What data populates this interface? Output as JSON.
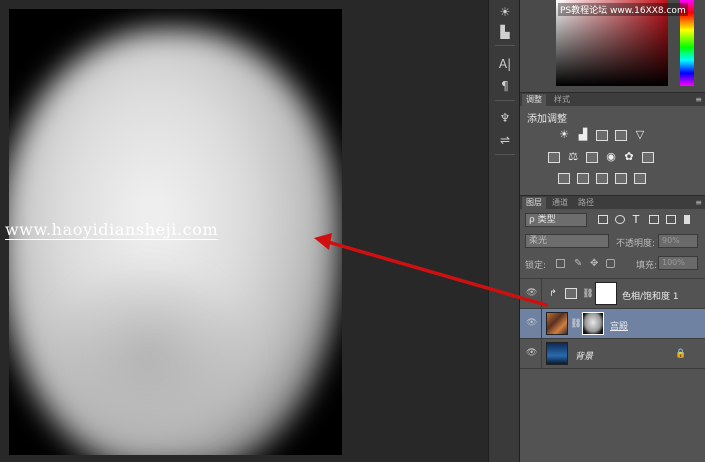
{
  "canvas": {
    "watermark": "www.haoyidiansheji.com"
  },
  "color_panel": {
    "credit": "PS教程论坛 www.16XX8.com",
    "accent_color": "#c01018"
  },
  "adjustments": {
    "tabs": [
      "调整",
      "样式"
    ],
    "title": "添加调整"
  },
  "layers": {
    "tabs": [
      "图层",
      "通道",
      "路径"
    ],
    "kind_select": "ρ 类型",
    "blend_mode": "柔光",
    "opacity_label": "不透明度:",
    "opacity_value": "90%",
    "lock_label": "锁定:",
    "fill_label": "填充:",
    "fill_value": "100%",
    "items": [
      {
        "name": "色相/饱和度 1",
        "type": "adjustment",
        "selected": false
      },
      {
        "name": "宫殿",
        "type": "photo-with-mask",
        "selected": true
      },
      {
        "name": "背景",
        "type": "background",
        "selected": false,
        "locked": true
      }
    ]
  },
  "colors": {
    "selected_layer": "#6f82a2",
    "arrow": "#d01010"
  }
}
